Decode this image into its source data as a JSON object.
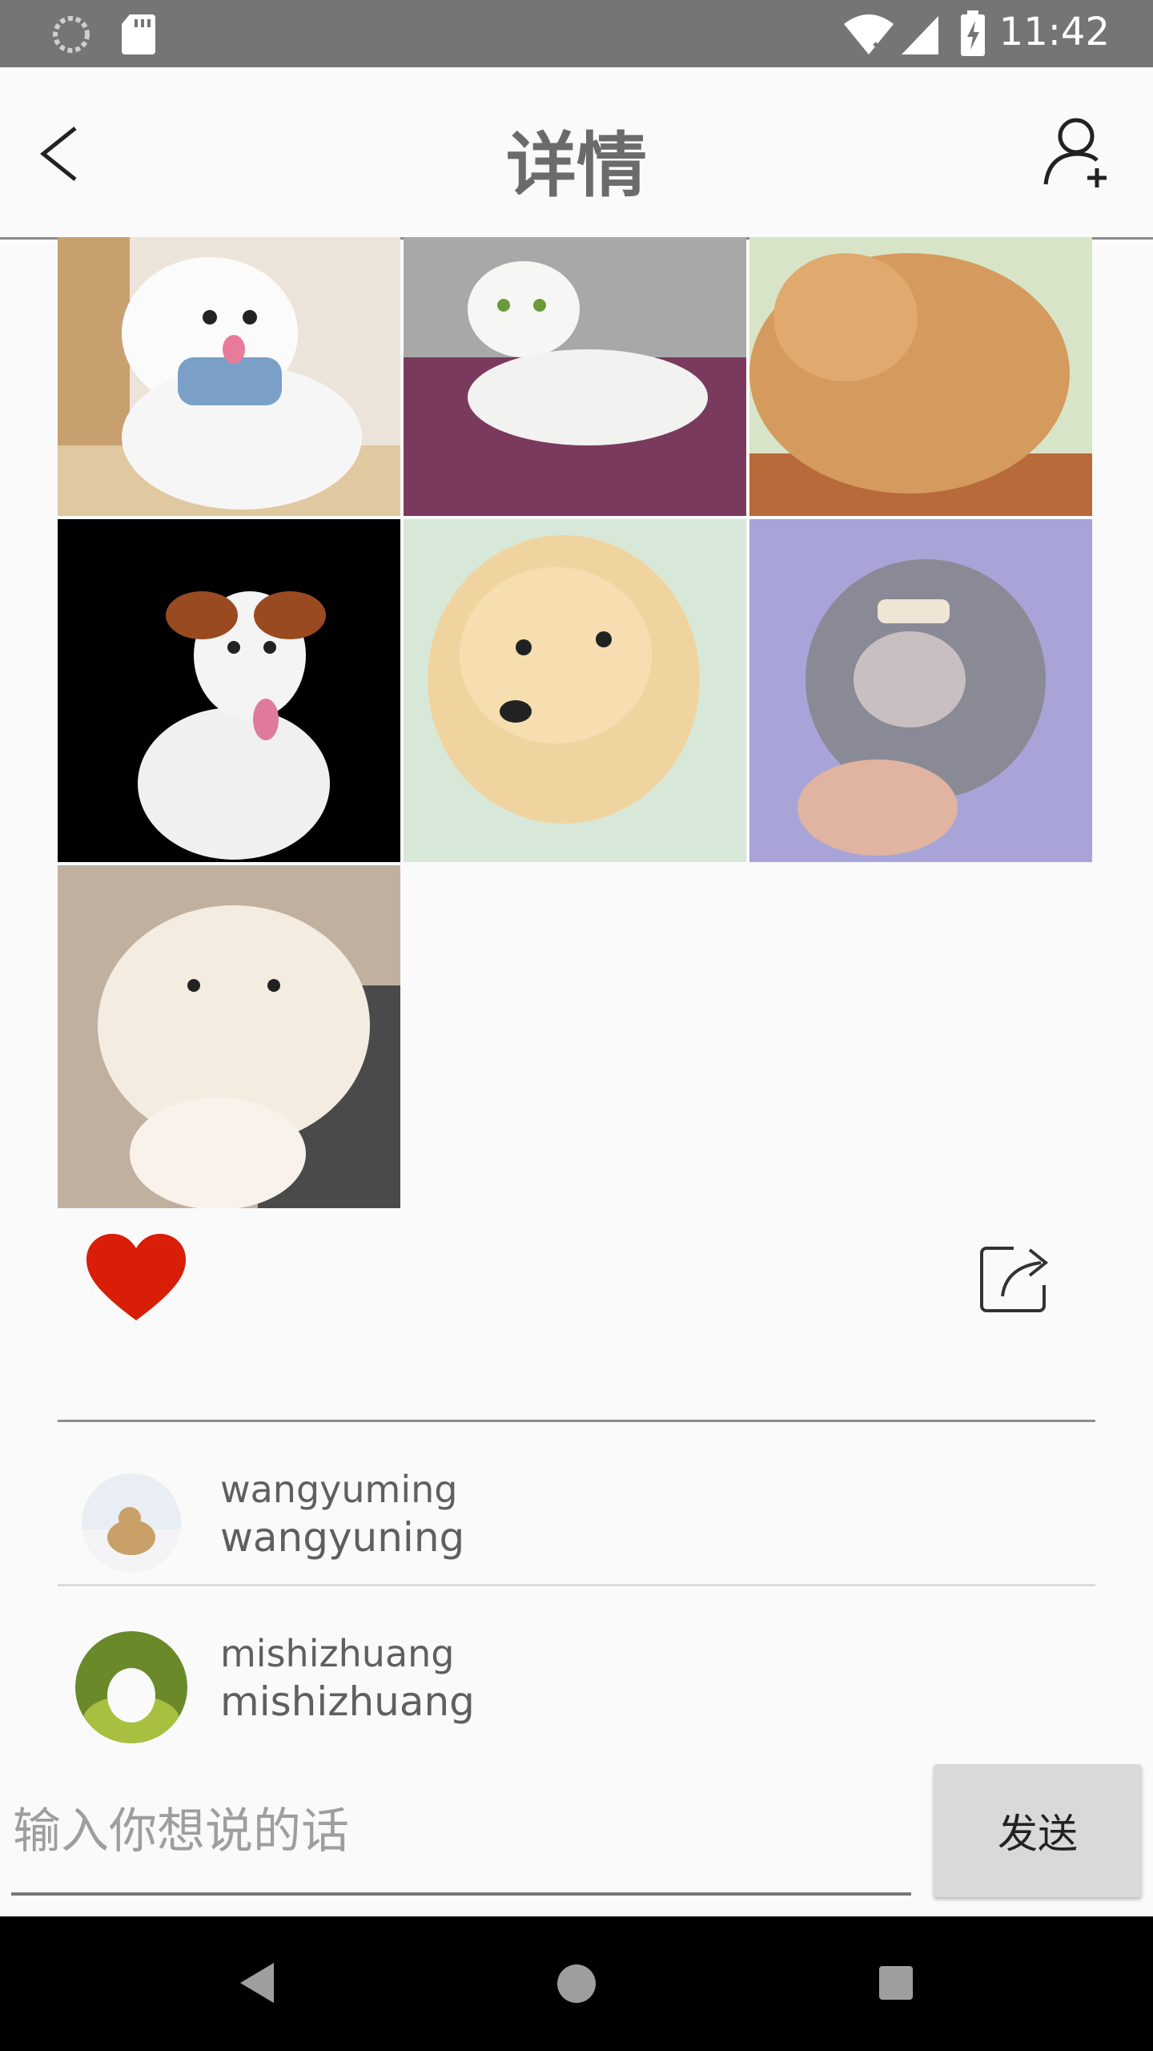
{
  "status_bar": {
    "time": "11:42",
    "icons": [
      "sync-icon",
      "sd-card-icon",
      "wifi-icon",
      "signal-icon",
      "battery-charging-icon"
    ]
  },
  "app_bar": {
    "title": "详情",
    "back_icon": "back-arrow-icon",
    "action_icon": "add-user-icon"
  },
  "photos": [
    {
      "subject": "white poodle"
    },
    {
      "subject": "white cat on sofa"
    },
    {
      "subject": "orange cat"
    },
    {
      "subject": "beagle puppy"
    },
    {
      "subject": "golden retriever puppy"
    },
    {
      "subject": "grey poodle"
    },
    {
      "subject": "white persian cat"
    }
  ],
  "actions": {
    "like_icon": "heart-icon",
    "like_color": "#d81e06",
    "share_icon": "share-icon"
  },
  "comments": [
    {
      "user": "wangyuming",
      "text": "wangyuning"
    },
    {
      "user": "mishizhuang",
      "text": "mishizhuang"
    }
  ],
  "composer": {
    "placeholder": "输入你想说的话",
    "send_label": "发送"
  },
  "nav_bar": {
    "icons": [
      "back-triangle-icon",
      "home-circle-icon",
      "recents-square-icon"
    ]
  }
}
